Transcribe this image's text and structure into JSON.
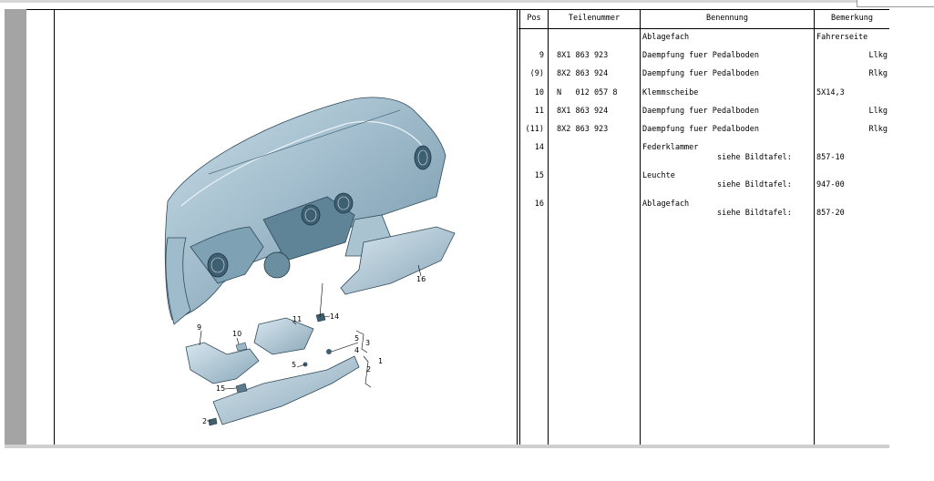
{
  "table": {
    "headers": {
      "pos": "Pos",
      "teilenummer": "Teilenummer",
      "benennung": "Benennung",
      "bemerkung": "Bemerkung"
    },
    "rows": [
      {
        "pos": "",
        "teilenummer": "",
        "benennung": "Ablagefach",
        "bemerkung": "Fahrerseite"
      },
      {
        "pos": "9",
        "teilenummer": "8X1 863 923",
        "benennung": "Daempfung fuer Pedalboden",
        "bemerkung": "Llkg"
      },
      {
        "pos": "(9)",
        "teilenummer": "8X2 863 924",
        "benennung": "Daempfung fuer Pedalboden",
        "bemerkung": "Rlkg"
      },
      {
        "pos": "10",
        "teilenummer": "N   012 057 8",
        "benennung": "Klemmscheibe",
        "bemerkung": "5X14,3"
      },
      {
        "pos": "11",
        "teilenummer": "8X1 863 924",
        "benennung": "Daempfung fuer Pedalboden",
        "bemerkung": "Llkg"
      },
      {
        "pos": "(11)",
        "teilenummer": "8X2 863 923",
        "benennung": "Daempfung fuer Pedalboden",
        "bemerkung": "Rlkg"
      },
      {
        "pos": "14",
        "teilenummer": "",
        "benennung": "Federklammer",
        "sub": "siehe Bildtafel:",
        "bemerkung": "857-10"
      },
      {
        "pos": "15",
        "teilenummer": "",
        "benennung": "Leuchte",
        "sub": "siehe Bildtafel:",
        "bemerkung": "947-00"
      },
      {
        "pos": "16",
        "teilenummer": "",
        "benennung": "Ablagefach",
        "sub": "siehe Bildtafel:",
        "bemerkung": "857-20"
      }
    ]
  },
  "illustration": {
    "callouts": [
      "16",
      "9",
      "10",
      "11",
      "14",
      "5",
      "3",
      "4",
      "1",
      "2",
      "5",
      "15",
      "2"
    ]
  }
}
